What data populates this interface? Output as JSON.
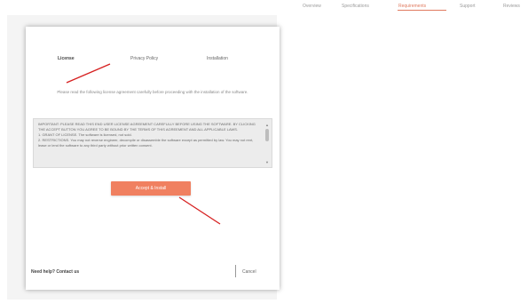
{
  "topnav": {
    "items": [
      {
        "label": "Overview"
      },
      {
        "label": "Specifications"
      },
      {
        "label": "Requirements"
      },
      {
        "label": "Support"
      },
      {
        "label": "Reviews"
      }
    ],
    "accent": "#e07a5f"
  },
  "window": {
    "tabs": [
      {
        "label": "License"
      },
      {
        "label": "Privacy Policy"
      },
      {
        "label": "Installation"
      }
    ],
    "instruction": "Please read the following license agreement carefully before proceeding with the installation of the software.",
    "license_paragraphs": [
      "IMPORTANT: PLEASE READ THIS END USER LICENSE AGREEMENT CAREFULLY BEFORE USING THE SOFTWARE. BY CLICKING THE ACCEPT BUTTON YOU AGREE TO BE BOUND BY THE TERMS OF THIS AGREEMENT AND ALL APPLICABLE LAWS.",
      "1. GRANT OF LICENSE. The software is licensed, not sold.",
      "2. RESTRICTIONS. You may not reverse engineer, decompile or disassemble the software except as permitted by law. You may not rent, lease or lend the software to any third party without prior written consent."
    ],
    "agree_button": "Accept & Install",
    "footer_left": "Need help? Contact us",
    "footer_right": "Cancel",
    "button_color": "#f08060"
  }
}
